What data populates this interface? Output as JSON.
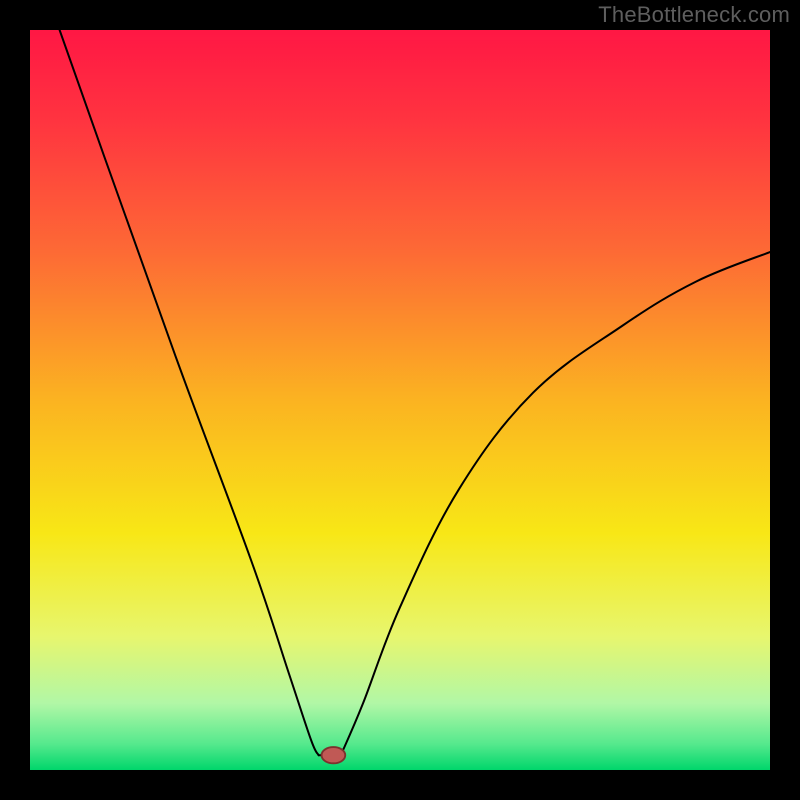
{
  "watermark": "TheBottleneck.com",
  "colors": {
    "frame": "#000000",
    "curve": "#000000",
    "marker_fill": "#c05955",
    "marker_stroke": "#7c322e",
    "gradient_stops": [
      {
        "offset": 0.0,
        "color": "#ff1744"
      },
      {
        "offset": 0.12,
        "color": "#ff3340"
      },
      {
        "offset": 0.3,
        "color": "#fd6a35"
      },
      {
        "offset": 0.5,
        "color": "#fbb321"
      },
      {
        "offset": 0.68,
        "color": "#f8e716"
      },
      {
        "offset": 0.82,
        "color": "#e7f66e"
      },
      {
        "offset": 0.91,
        "color": "#b1f7a6"
      },
      {
        "offset": 0.965,
        "color": "#55e98d"
      },
      {
        "offset": 1.0,
        "color": "#00d66b"
      }
    ]
  },
  "chart_data": {
    "type": "line",
    "title": "",
    "xlabel": "",
    "ylabel": "",
    "xlim": [
      0,
      100
    ],
    "ylim": [
      0,
      100
    ],
    "grid": false,
    "curve_left": {
      "comment": "Steep near-linear descent from top-left down to the minimum",
      "points": [
        {
          "x": 4,
          "y": 100
        },
        {
          "x": 10,
          "y": 83
        },
        {
          "x": 20,
          "y": 55
        },
        {
          "x": 30,
          "y": 28
        },
        {
          "x": 35,
          "y": 13
        },
        {
          "x": 38,
          "y": 4
        },
        {
          "x": 39,
          "y": 2
        }
      ]
    },
    "minimum_flat": {
      "comment": "Short flat segment at the bottom of the V",
      "points": [
        {
          "x": 39,
          "y": 2
        },
        {
          "x": 42,
          "y": 2
        }
      ]
    },
    "curve_right": {
      "comment": "Rising arc from minimum toward upper-right, decelerating",
      "points": [
        {
          "x": 42,
          "y": 2
        },
        {
          "x": 45,
          "y": 9
        },
        {
          "x": 50,
          "y": 22
        },
        {
          "x": 58,
          "y": 38
        },
        {
          "x": 68,
          "y": 51
        },
        {
          "x": 80,
          "y": 60
        },
        {
          "x": 90,
          "y": 66
        },
        {
          "x": 100,
          "y": 70
        }
      ]
    },
    "marker": {
      "x": 41,
      "y": 2,
      "rx": 1.6,
      "ry": 1.1
    }
  }
}
